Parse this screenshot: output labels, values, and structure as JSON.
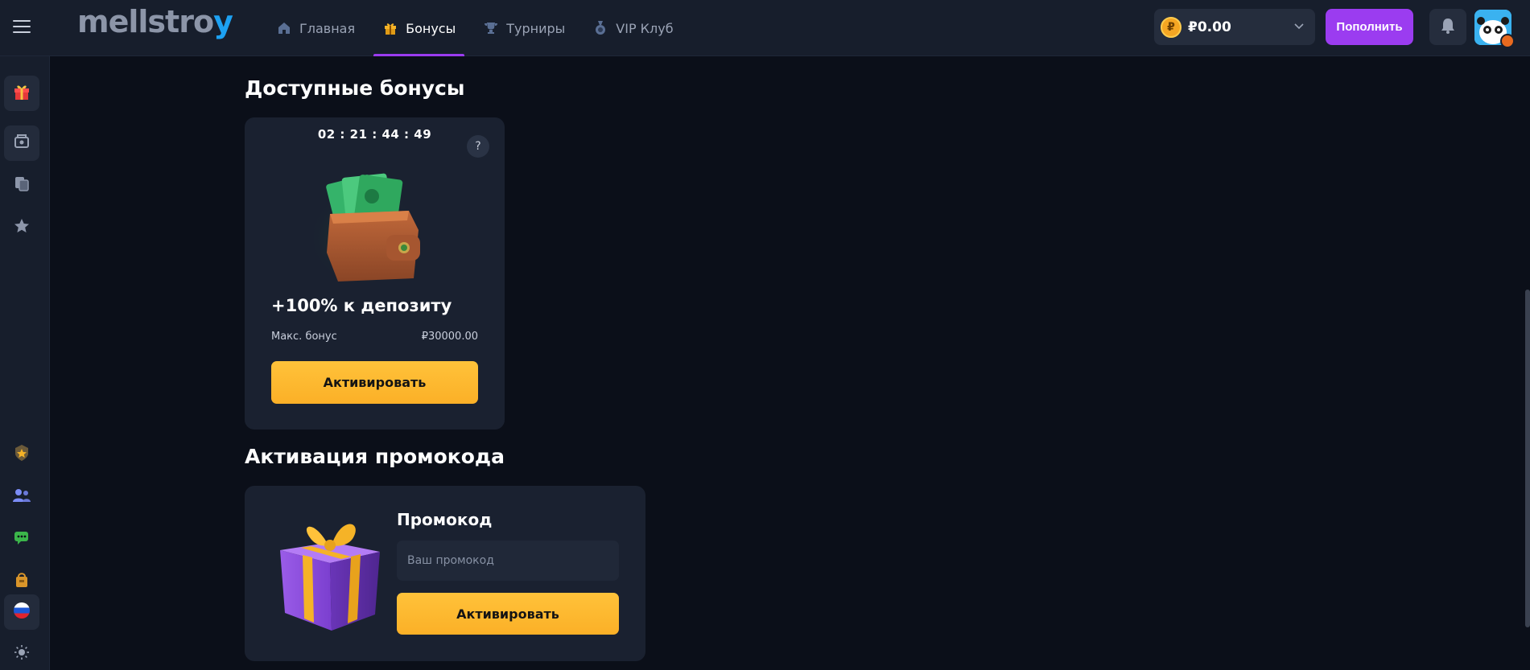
{
  "header": {
    "logo_text": "mellstroy",
    "nav": [
      {
        "label": "Главная",
        "icon": "home-icon",
        "active": false
      },
      {
        "label": "Бонусы",
        "icon": "gift-icon",
        "active": true
      },
      {
        "label": "Турниры",
        "icon": "trophy-icon",
        "active": false
      },
      {
        "label": "VIP Клуб",
        "icon": "vip-icon",
        "active": false
      }
    ],
    "balance": "₽0.00",
    "coin_symbol": "₽",
    "deposit_label": "Пополнить"
  },
  "sidebar": {
    "items": [
      {
        "icon": "gift-icon"
      },
      {
        "icon": "casino-chip-icon"
      },
      {
        "icon": "copy-icon"
      },
      {
        "icon": "star-icon"
      },
      {
        "icon": "badge-icon"
      },
      {
        "icon": "users-icon"
      },
      {
        "icon": "chat-icon"
      },
      {
        "icon": "bag-icon"
      },
      {
        "icon": "russia-flag-icon"
      },
      {
        "icon": "sun-icon"
      }
    ]
  },
  "bonuses": {
    "title": "Доступные бонусы",
    "card": {
      "timer": "02 : 21 : 44 : 49",
      "help": "?",
      "title": "+100% к депозиту",
      "max_label": "Макс. бонус",
      "max_value": "₽30000.00",
      "button": "Активировать"
    }
  },
  "promo": {
    "title": "Активация промокода",
    "label": "Промокод",
    "placeholder": "Ваш промокод",
    "value": "",
    "button": "Активировать"
  },
  "colors": {
    "background": "#0b0f19",
    "panel": "#171e2c",
    "card": "#1a2130",
    "accent_purple": "#9b3cf0",
    "accent_yellow": "#ffc23a"
  }
}
